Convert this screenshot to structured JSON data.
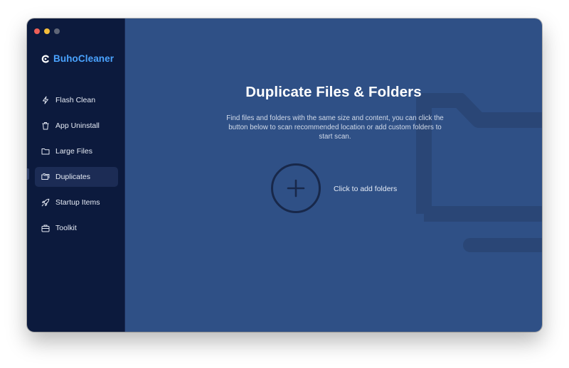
{
  "app": {
    "name": "BuhoCleaner"
  },
  "sidebar": {
    "items": [
      {
        "label": "Flash Clean",
        "icon": "flash-icon",
        "active": false
      },
      {
        "label": "App Uninstall",
        "icon": "trash-icon",
        "active": false
      },
      {
        "label": "Large Files",
        "icon": "folder-icon",
        "active": false
      },
      {
        "label": "Duplicates",
        "icon": "duplicate-folders-icon",
        "active": true
      },
      {
        "label": "Startup Items",
        "icon": "rocket-icon",
        "active": false
      },
      {
        "label": "Toolkit",
        "icon": "toolkit-icon",
        "active": false
      }
    ]
  },
  "main": {
    "title": "Duplicate Files & Folders",
    "description": "Find files and folders with the same size and content, you can click the button below to scan recommended location or add custom folders to start scan.",
    "add_button_label": "Click to add folders"
  },
  "colors": {
    "sidebar_bg": "#0c1a3d",
    "main_bg": "#2f5086",
    "brand_accent": "#4aa3ff",
    "active_item_bg": "#1c2c55"
  }
}
